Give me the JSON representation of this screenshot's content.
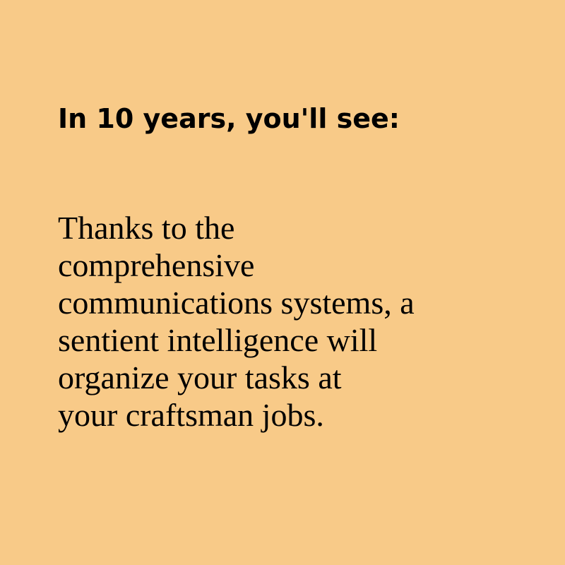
{
  "card": {
    "background": "#f8ca88",
    "heading": "In 10 years, you'll see:",
    "body_lines": [
      "Thanks to the",
      "comprehensive",
      "communications systems, a",
      "sentient intelligence will",
      "organize your tasks at",
      "your craftsman jobs."
    ]
  }
}
